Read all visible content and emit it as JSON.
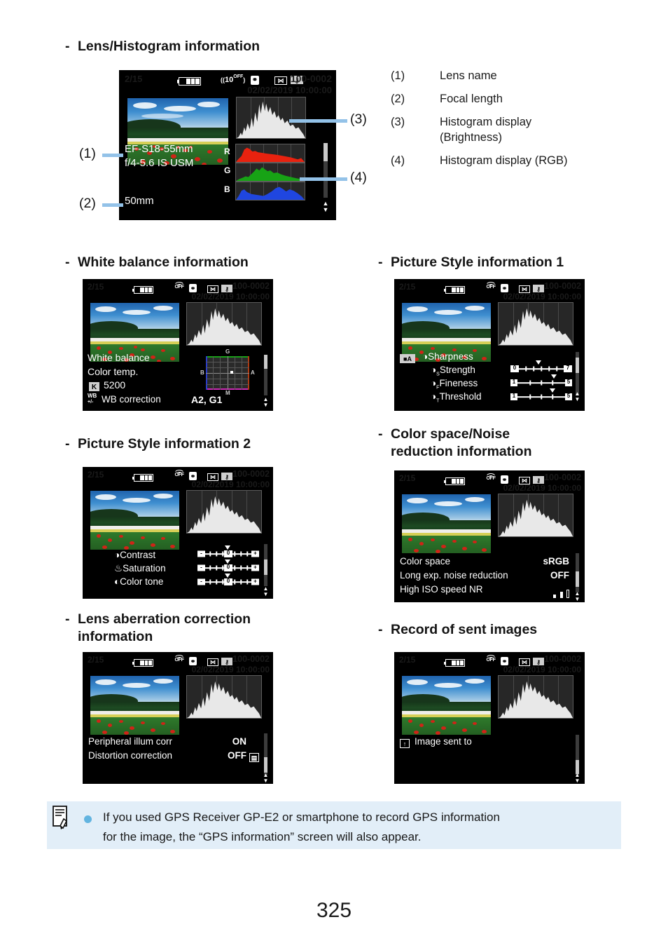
{
  "page_number": "325",
  "sections": [
    {
      "id": "lens-histogram",
      "dash": "-",
      "title": "Lens/Histogram information"
    },
    {
      "id": "white-balance",
      "dash": "-",
      "title": "White balance information"
    },
    {
      "id": "picture-style-1",
      "dash": "-",
      "title": "Picture Style information 1"
    },
    {
      "id": "picture-style-2",
      "dash": "-",
      "title": "Picture Style information 2"
    },
    {
      "id": "color-space",
      "dash": "-",
      "title_line1": "Color space/Noise",
      "title_line2": "reduction information"
    },
    {
      "id": "lens-aberration",
      "dash": "-",
      "title_line1": "Lens aberration correction",
      "title_line2": "information"
    },
    {
      "id": "record-sent",
      "dash": "-",
      "title": "Record of sent images"
    }
  ],
  "legend": {
    "items": [
      {
        "num": "(1)",
        "text": "Lens name"
      },
      {
        "num": "(2)",
        "text": "Focal length"
      },
      {
        "num": "(3)",
        "text": "Histogram display",
        "text2": "(Brightness)"
      },
      {
        "num": "(4)",
        "text": "Histogram display (RGB)"
      }
    ]
  },
  "callouts": [
    {
      "num": "(1)",
      "target": "lens-name"
    },
    {
      "num": "(2)",
      "target": "focal-length"
    },
    {
      "num": "(3)",
      "target": "histogram-brightness"
    },
    {
      "num": "(4)",
      "target": "histogram-rgb"
    }
  ],
  "status_bar": {
    "index": "2/15",
    "battery": "battery-full-icon",
    "wifi": "wifi-off-icon",
    "bluetooth": "bluetooth-icon",
    "crop": "crop-icon",
    "protect": "protect-key-icon",
    "file_number": "100-0002",
    "datetime": "02/02/2019 10:00:00",
    "wifi_label": "OFF"
  },
  "screens": {
    "lens_histogram": {
      "lens_name_line1": "EF-S18-55mm",
      "lens_name_line2": "f/4-5.6  IS  USM",
      "focal_length": "50mm",
      "rgb_labels": [
        "R",
        "G",
        "B"
      ]
    },
    "white_balance": {
      "label_white_balance": "White balance",
      "label_color_temp": "Color temp.",
      "kelvin_icon": "K",
      "kelvin_value": "5200",
      "wb_correction_icon": "WB",
      "label_wb_correction": "WB correction",
      "wb_correction_value": "A2, G1",
      "grid_labels": {
        "top": "G",
        "right": "A",
        "bottom": "M",
        "left": "B"
      }
    },
    "picture_style_1": {
      "style_icon": "picture-style-auto-icon",
      "rows": [
        {
          "icon": "sharpness-icon",
          "label": "Sharpness",
          "min": "",
          "max": "",
          "pointer": 0.0
        },
        {
          "icon": "strength-icon",
          "label": "Strength",
          "min": "0",
          "max": "7",
          "pointer": 0.45
        },
        {
          "icon": "fineness-icon",
          "label": "Fineness",
          "min": "1",
          "max": "5",
          "pointer": 0.8
        },
        {
          "icon": "threshold-icon",
          "label": "Threshold",
          "min": "1",
          "max": "5",
          "pointer": 0.78
        }
      ]
    },
    "picture_style_2": {
      "rows": [
        {
          "icon": "contrast-icon",
          "label": "Contrast",
          "min": "-",
          "max": "+",
          "value": "0"
        },
        {
          "icon": "saturation-icon",
          "label": "Saturation",
          "min": "-",
          "max": "+",
          "value": "0"
        },
        {
          "icon": "color-tone-icon",
          "label": "Color tone",
          "min": "-",
          "max": "+",
          "value": "0"
        }
      ]
    },
    "color_space": {
      "rows": [
        {
          "label": "Color space",
          "value": "sRGB"
        },
        {
          "label": "Long exp. noise reduction",
          "value": "OFF"
        },
        {
          "label": "High ISO speed NR",
          "value": "bars-icon"
        }
      ]
    },
    "lens_aberration": {
      "rows": [
        {
          "label": "Peripheral illum corr",
          "value": "ON"
        },
        {
          "label": "Distortion correction",
          "value": "OFF",
          "suffix_icon": "lens-data-icon"
        }
      ]
    },
    "record_sent": {
      "icon": "sent-image-icon",
      "label": "Image sent to"
    }
  },
  "note": {
    "icon": "note-memo-icon",
    "bullet": "bullet-dot",
    "line1": "If you used GPS Receiver GP-E2 or smartphone to record GPS information",
    "line2": "for the image, the “GPS information” screen will also appear."
  },
  "colors": {
    "leader_line": "#93c2e8",
    "note_bg": "#e2eef8",
    "note_bullet": "#62b4e0",
    "lcd_bg": "#000000",
    "histogram_fill": "#e8e8e8",
    "red": "#e8220f",
    "green": "#17a315",
    "blue": "#1f46e0"
  }
}
